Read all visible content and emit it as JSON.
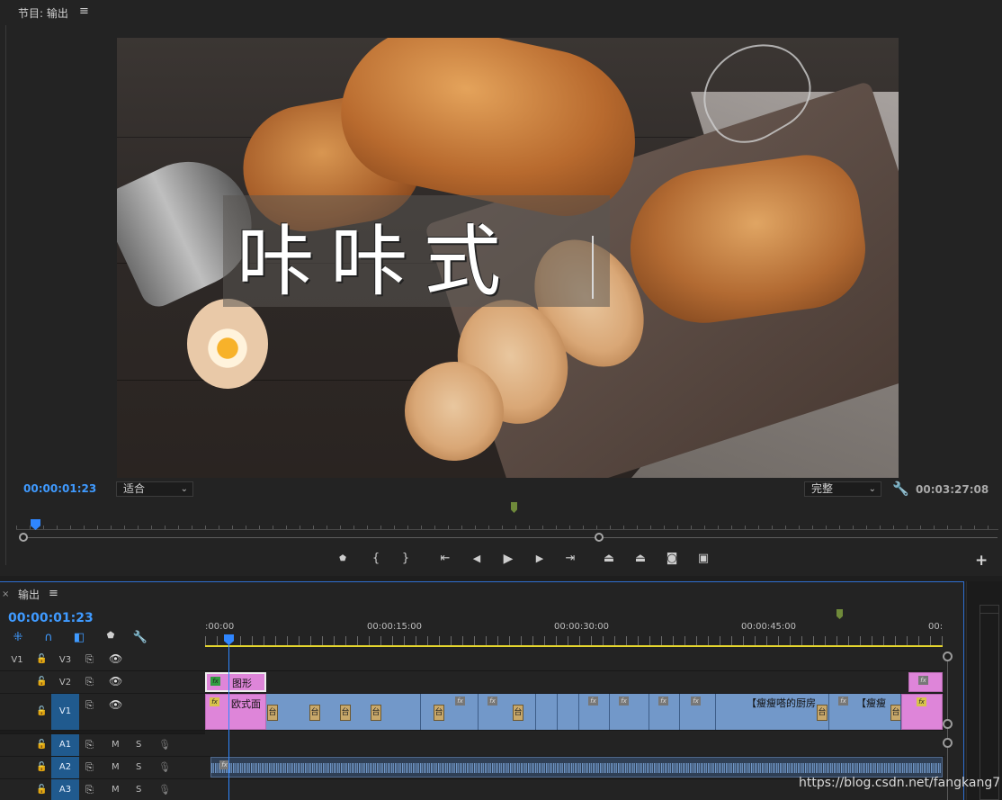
{
  "monitor": {
    "title": "节目: 输出",
    "menu_glyph": "≡",
    "title_overlay": "咔咔式",
    "timecode_current": "00:00:01:23",
    "fit_value": "适合",
    "quality_value": "完整",
    "timecode_duration": "00:03:27:08",
    "add_glyph": "+"
  },
  "transport": {
    "icons": [
      "marker-icon",
      "mark-in-icon",
      "mark-out-icon",
      "go-to-in-icon",
      "step-back-icon",
      "play-icon",
      "step-forward-icon",
      "go-to-out-icon",
      "lift-icon",
      "extract-icon",
      "export-frame-icon",
      "compare-icon"
    ],
    "glyphs": [
      "⬤",
      "{",
      "}",
      "⇤",
      "◀",
      "▶",
      "▶",
      "⇥",
      "⇪",
      "⇫",
      "◉",
      "▣"
    ]
  },
  "timeline": {
    "close_glyph": "×",
    "title": "输出",
    "menu_glyph": "≡",
    "timecode": "00:00:01:23",
    "ruler_labels": [
      ":00:00",
      "00:00:15:00",
      "00:00:30:00",
      "00:00:45:00",
      "00:"
    ],
    "tracks": {
      "v3": {
        "src": "V1",
        "id": "V3"
      },
      "v2": {
        "id": "V2"
      },
      "v1": {
        "id": "V1"
      },
      "a1": {
        "id": "A1",
        "m": "M",
        "s": "S"
      },
      "a2": {
        "id": "A2",
        "m": "M",
        "s": "S"
      },
      "a3": {
        "id": "A3",
        "m": "M",
        "s": "S"
      }
    },
    "clips": {
      "v2_graphic": "图形",
      "v1_first": "欧式面",
      "v1_label_a": "【瘦瘦嗒的厨房",
      "v1_label_b": "【瘦瘦",
      "fx": "fx",
      "mini": "台"
    }
  },
  "watermark": "https://blog.csdn.net/fangkang7",
  "colors": {
    "accent": "#3f9aff",
    "clip_video": "#7298c9",
    "clip_graphic": "#de85d9",
    "work_area": "#e5d62e"
  }
}
